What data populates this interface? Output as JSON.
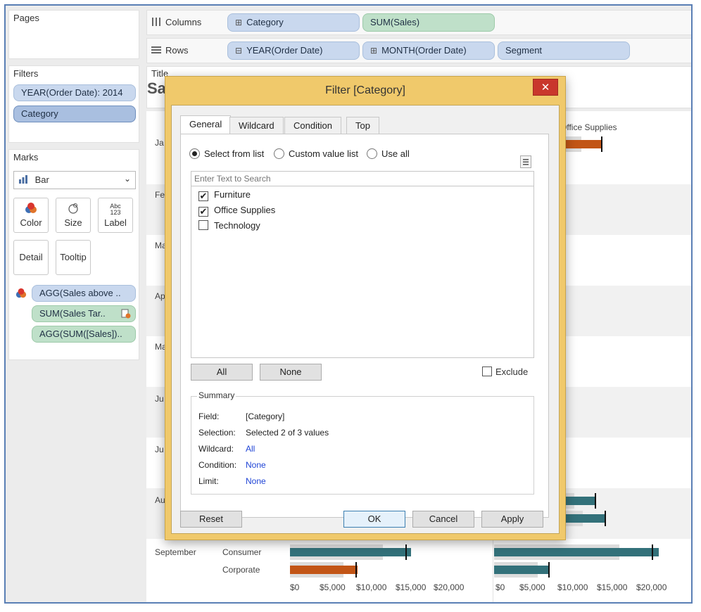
{
  "sidebar": {
    "pages_title": "Pages",
    "filters_title": "Filters",
    "filters": [
      "YEAR(Order Date): 2014",
      "Category"
    ],
    "marks_title": "Marks",
    "mark_type": "Bar",
    "mark_buttons": {
      "color": "Color",
      "size": "Size",
      "label": "Label",
      "label_icon_top": "Abc",
      "label_icon_bottom": "123",
      "detail": "Detail",
      "tooltip": "Tooltip"
    },
    "mark_fields": [
      "AGG(Sales above ..",
      "SUM(Sales Tar..",
      "AGG(SUM([Sales]).."
    ]
  },
  "shelves": {
    "columns_label": "Columns",
    "rows_label": "Rows",
    "columns": [
      {
        "prefix": "⊞",
        "label": "Category"
      },
      {
        "prefix": "",
        "label": "SUM(Sales)"
      }
    ],
    "rows": [
      {
        "prefix": "⊟",
        "label": "YEAR(Order Date)"
      },
      {
        "prefix": "⊞",
        "label": "MONTH(Order Date)"
      },
      {
        "prefix": "",
        "label": "Segment"
      }
    ]
  },
  "title_label": "Title",
  "title_partial": "Sa",
  "viz": {
    "column_header": "Office Supplies",
    "month_fragments": [
      "Ja",
      "Fe",
      "Ma",
      "Ap",
      "Ma",
      "Ju",
      "Ju",
      "Au"
    ],
    "september": "September",
    "segments": [
      "Consumer",
      "Corporate"
    ],
    "axis_ticks": [
      "$0",
      "$5,000",
      "$10,000",
      "$15,000",
      "$20,000"
    ],
    "colors": {
      "teal": "#33717a",
      "orange": "#c25516",
      "target_band": "#dcdcdc"
    }
  },
  "dialog": {
    "title": "Filter [Category]",
    "close_glyph": "✕",
    "tabs": [
      "General",
      "Wildcard",
      "Condition",
      "Top"
    ],
    "active_tab": "General",
    "radio_options": [
      "Select from list",
      "Custom value list",
      "Use all"
    ],
    "selected_radio": "Select from list",
    "search_placeholder": "Enter Text to Search",
    "items": [
      {
        "label": "Furniture",
        "checked": true
      },
      {
        "label": "Office Supplies",
        "checked": true
      },
      {
        "label": "Technology",
        "checked": false
      }
    ],
    "all_button": "All",
    "none_button": "None",
    "exclude_label": "Exclude",
    "summary": {
      "title": "Summary",
      "field_label": "Field:",
      "field_value": "[Category]",
      "selection_label": "Selection:",
      "selection_value": "Selected 2 of 3 values",
      "wildcard_label": "Wildcard:",
      "wildcard_value": "All",
      "condition_label": "Condition:",
      "condition_value": "None",
      "limit_label": "Limit:",
      "limit_value": "None"
    },
    "buttons": {
      "reset": "Reset",
      "ok": "OK",
      "cancel": "Cancel",
      "apply": "Apply"
    }
  }
}
